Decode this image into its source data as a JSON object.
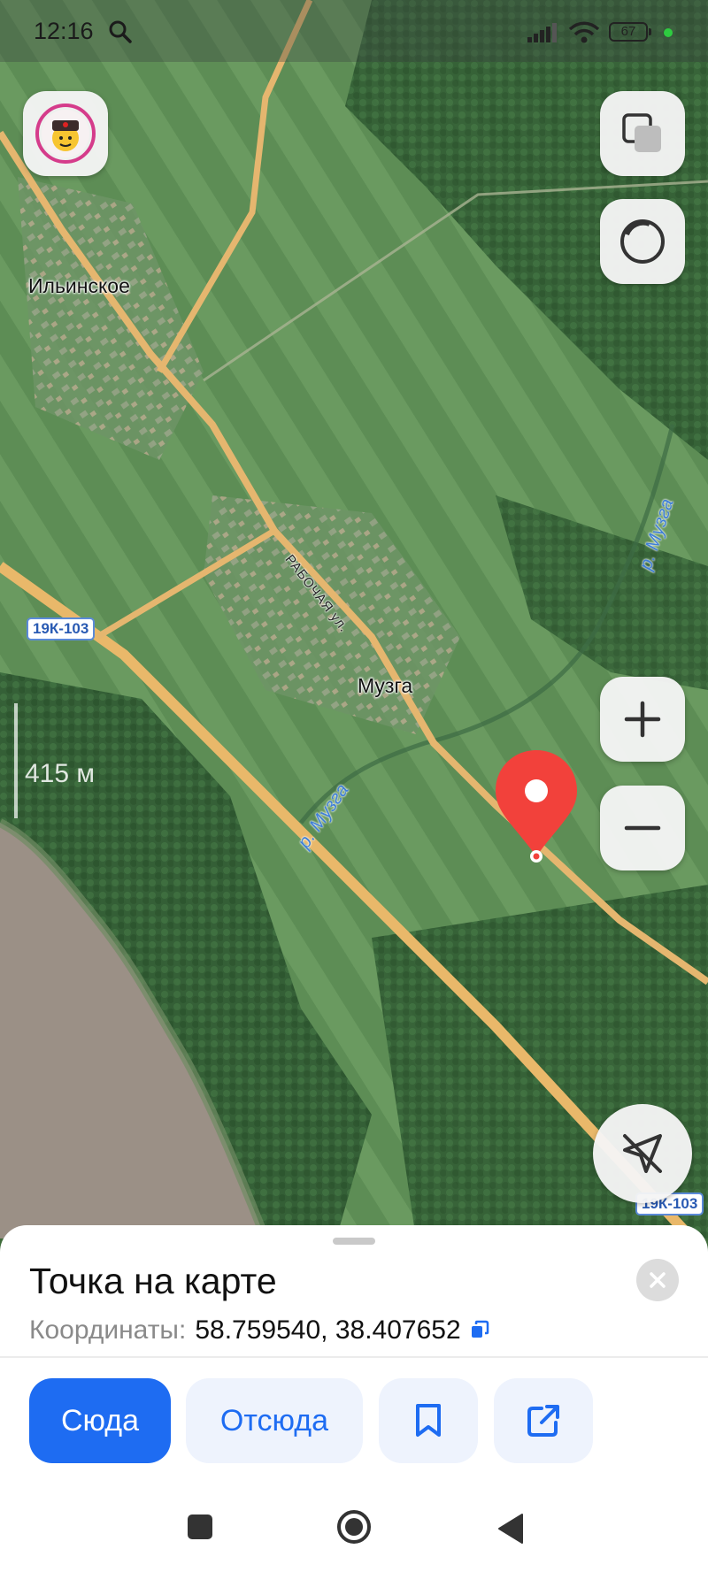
{
  "status_bar": {
    "time": "12:16",
    "battery": "67",
    "icons": [
      "search-icon",
      "signal-icon",
      "wifi-icon",
      "battery-icon",
      "notification-dot"
    ]
  },
  "map": {
    "place_labels": {
      "ilinskoe": "Ильинское",
      "muzga": "Музга"
    },
    "river_labels": {
      "east": "р. Музга",
      "south": "р. Музга"
    },
    "street_label": "РАБОЧАЯ ул.",
    "road_badges": {
      "west": "19К-103",
      "east": "19К-103"
    },
    "scale_label": "415 м",
    "pin_icon": "location-pin-icon"
  },
  "controls": {
    "avatar_icon": "profile-avatar-icon",
    "layers_icon": "layers-icon",
    "compass_icon": "compass-icon",
    "zoom_in_icon": "plus-icon",
    "zoom_out_icon": "minus-icon",
    "navigation_icon": "navigation-off-icon"
  },
  "sheet": {
    "title": "Точка на карте",
    "coords_label": "Координаты:",
    "coords_value": "58.759540, 38.407652",
    "actions": {
      "here": "Сюда",
      "from": "Отсюда",
      "bookmark_icon": "bookmark-icon",
      "share_icon": "share-icon"
    }
  },
  "colors": {
    "accent": "#1e6cf2",
    "pin": "#f2413b",
    "road": "#e9b86a"
  }
}
